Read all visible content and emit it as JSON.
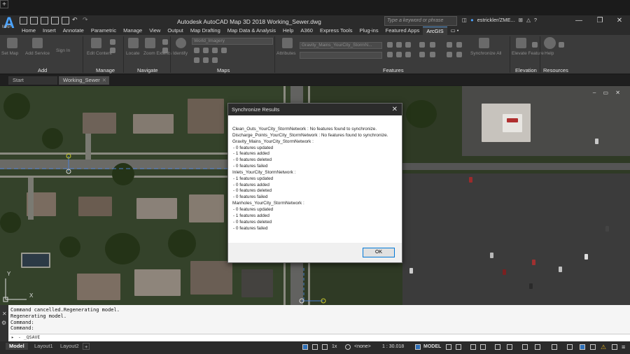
{
  "app": {
    "logo_letter": "A",
    "logo_sub": "MAP",
    "title": "Autodesk AutoCAD Map 3D 2018   Working_Sewer.dwg",
    "search_placeholder": "Type a keyword or phrase",
    "user": "estrickler/ZME...",
    "window_controls": [
      "—",
      "❐",
      "✕"
    ]
  },
  "menu_tabs": [
    "Home",
    "Insert",
    "Annotate",
    "Parametric",
    "Manage",
    "View",
    "Output",
    "Map Drafting",
    "Map Data & Analysis",
    "Help",
    "A360",
    "Express Tools",
    "Plug-ins",
    "Featured Apps",
    "ArcGIS",
    "▭ •"
  ],
  "active_menu_tab": "ArcGIS",
  "ribbon": {
    "panels": [
      "Add",
      "Manage",
      "Navigate",
      "Maps",
      "Features",
      "Elevation",
      "Resources"
    ],
    "buttons": {
      "set_map": "Set Map",
      "add_service": "Add Service",
      "sign_in": "Sign In",
      "edit_content": "Edit Content",
      "locate": "Locate",
      "zoom_extents": "Zoom Extents",
      "identify": "Identify",
      "attributes": "Attributes",
      "synchronize_all": "Synchronize All",
      "elevate": "Elevate Feature",
      "help": "Help"
    },
    "basemap_combo": "World_Imagery",
    "layer_combo": "Gravity_Mains_YourCity_StormN..."
  },
  "file_tabs": {
    "start": "Start",
    "working": "Working_Sewer",
    "add": "+"
  },
  "viewport": {
    "controls": "–  ▭  ✕",
    "ucs_y": "Y",
    "ucs_x": "X"
  },
  "dialog": {
    "title": "Synchronize Results",
    "close": "✕",
    "lines": [
      "Clean_Outs_YourCity_StormNetwork : No features found to synchronize.",
      "Discharge_Points_YourCity_StormNetwork : No features found to synchronize.",
      "Gravity_Mains_YourCity_StormNetwork :",
      " - 0  features updated",
      " - 1  features added",
      " - 0  features deleted",
      " - 0  features failed",
      "Inlets_YourCity_StormNetwork :",
      " - 1  features updated",
      " - 0  features added",
      " - 0  features deleted",
      " - 0  features failed",
      "Manholes_YourCity_StormNetwork :",
      " - 0  features updated",
      " - 1  features added",
      " - 0  features deleted",
      " - 0  features failed"
    ],
    "ok": "OK"
  },
  "command": {
    "history": [
      "Command cancelled.Regenerating model.",
      "Regenerating model.",
      "Command:",
      "Command:"
    ],
    "input": "- _QSAVE"
  },
  "status": {
    "layouts": [
      "Model",
      "Layout1",
      "Layout2",
      "+"
    ],
    "scale_factor": "1x",
    "coord_system": "<none>",
    "map_scale": "1 : 30.018",
    "space": "MODEL"
  }
}
